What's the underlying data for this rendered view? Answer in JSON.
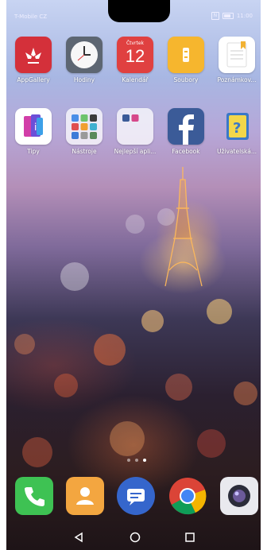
{
  "statusbar": {
    "carrier": "T-Mobile CZ",
    "time": "11:00",
    "nfc": "N"
  },
  "apps_row1": [
    {
      "label": "AppGallery",
      "icon": "appgallery-icon"
    },
    {
      "label": "Hodiny",
      "icon": "clock-icon"
    },
    {
      "label": "Kalendář",
      "icon": "calendar-icon",
      "day_name": "Čtvrtek",
      "day_number": "12"
    },
    {
      "label": "Soubory",
      "icon": "files-icon"
    },
    {
      "label": "Poznámkov...",
      "icon": "notes-icon"
    }
  ],
  "apps_row2": [
    {
      "label": "Tipy",
      "icon": "tips-icon"
    },
    {
      "label": "Nástroje",
      "icon": "tools-folder-icon"
    },
    {
      "label": "Nejlepší apli...",
      "icon": "top-apps-folder-icon"
    },
    {
      "label": "Facebook",
      "icon": "facebook-icon"
    },
    {
      "label": "Uživatelská...",
      "icon": "user-guide-icon"
    }
  ],
  "page_indicator": {
    "count": 3,
    "active_index": 2
  },
  "dock": [
    {
      "name": "phone",
      "icon": "phone-icon"
    },
    {
      "name": "contacts",
      "icon": "contacts-icon"
    },
    {
      "name": "messages",
      "icon": "messages-icon"
    },
    {
      "name": "chrome",
      "icon": "chrome-icon"
    },
    {
      "name": "camera",
      "icon": "camera-icon"
    }
  ],
  "colors": {
    "appgallery": "#d4303a",
    "calendar_header": "#e04040",
    "files": "#f6b62e",
    "facebook": "#3b5b98",
    "phone": "#3ec253",
    "contacts": "#f3a640",
    "messages": "#3566cc"
  }
}
